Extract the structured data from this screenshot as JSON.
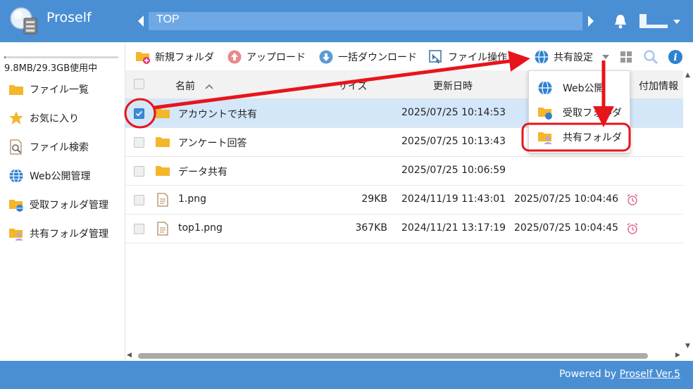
{
  "app": {
    "brand": "Proself"
  },
  "header": {
    "path": "TOP"
  },
  "sidebar": {
    "quota_text": "9.8MB/29.3GB使用中",
    "quota_fraction": 0.003,
    "items": [
      {
        "label": "ファイル一覧",
        "icon": "folder-icon"
      },
      {
        "label": "お気に入り",
        "icon": "star-icon"
      },
      {
        "label": "ファイル検索",
        "icon": "file-search-icon"
      },
      {
        "label": "Web公開管理",
        "icon": "globe-icon"
      },
      {
        "label": "受取フォルダ管理",
        "icon": "receive-folder-icon"
      },
      {
        "label": "共有フォルダ管理",
        "icon": "shared-folder-icon"
      }
    ]
  },
  "toolbar": {
    "new_folder": "新規フォルダ",
    "upload": "アップロード",
    "bulk_download": "一括ダウンロード",
    "file_ops": "ファイル操作",
    "share_settings": "共有設定"
  },
  "table": {
    "headers": {
      "name": "名前",
      "size": "サイズ",
      "updated": "更新日時",
      "created": "",
      "info": "付加情報"
    },
    "rows": [
      {
        "name": "アカウントで共有",
        "type": "folder",
        "size": "",
        "updated": "2025/07/25 10:14:53",
        "created": "",
        "checked": true
      },
      {
        "name": "アンケート回答",
        "type": "folder",
        "size": "",
        "updated": "2025/07/25 10:13:43",
        "created": "",
        "checked": false
      },
      {
        "name": "データ共有",
        "type": "folder",
        "size": "",
        "updated": "2025/07/25 10:06:59",
        "created": "",
        "checked": false
      },
      {
        "name": "1.png",
        "type": "file",
        "size": "29KB",
        "updated": "2024/11/19 11:43:01",
        "created": "2025/07/25 10:04:46",
        "checked": false
      },
      {
        "name": "top1.png",
        "type": "file",
        "size": "367KB",
        "updated": "2024/11/21 13:17:19",
        "created": "2025/07/25 10:04:45",
        "checked": false
      }
    ]
  },
  "dropdown": {
    "items": [
      {
        "label": "Web公開"
      },
      {
        "label": "受取フォルダ"
      },
      {
        "label": "共有フォルダ"
      }
    ]
  },
  "footer": {
    "prefix": "Powered by ",
    "link": "Proself Ver.5"
  },
  "colors": {
    "header_blue": "#4a8fd4",
    "selected_row": "#d3e7f9",
    "annotation_red": "#e8141b"
  }
}
